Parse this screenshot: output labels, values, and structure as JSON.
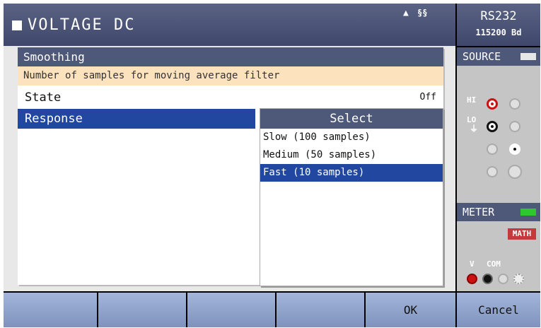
{
  "header": {
    "title": "VOLTAGE DC",
    "status_icons": [
      "warning-icon",
      "remote-icon"
    ]
  },
  "interface": {
    "name": "RS232",
    "baud": "115200 Bd"
  },
  "dialog": {
    "title": "Smoothing",
    "description": "Number of samples for moving average filter",
    "rows": [
      {
        "label": "State",
        "value": "Off"
      },
      {
        "label": "Response"
      }
    ]
  },
  "select": {
    "title": "Select",
    "options": [
      "Slow (100 samples)",
      "Medium (50 samples)",
      "Fast (10 samples)"
    ],
    "selected_index": 2
  },
  "side": {
    "source": {
      "title": "SOURCE",
      "hi": "HI",
      "lo": "LO"
    },
    "meter": {
      "title": "METER",
      "math": "MATH",
      "v": "V",
      "com": "COM"
    }
  },
  "softkeys": [
    "",
    "",
    "",
    "",
    "OK",
    "Cancel"
  ],
  "colors": {
    "title_bar": "#4e5878",
    "selection": "#2247a0",
    "info_bar": "#fde3bd",
    "softkey": "#8fa3cb",
    "meter_indicator": "#2ec82e",
    "math_badge": "#c43a3a"
  }
}
